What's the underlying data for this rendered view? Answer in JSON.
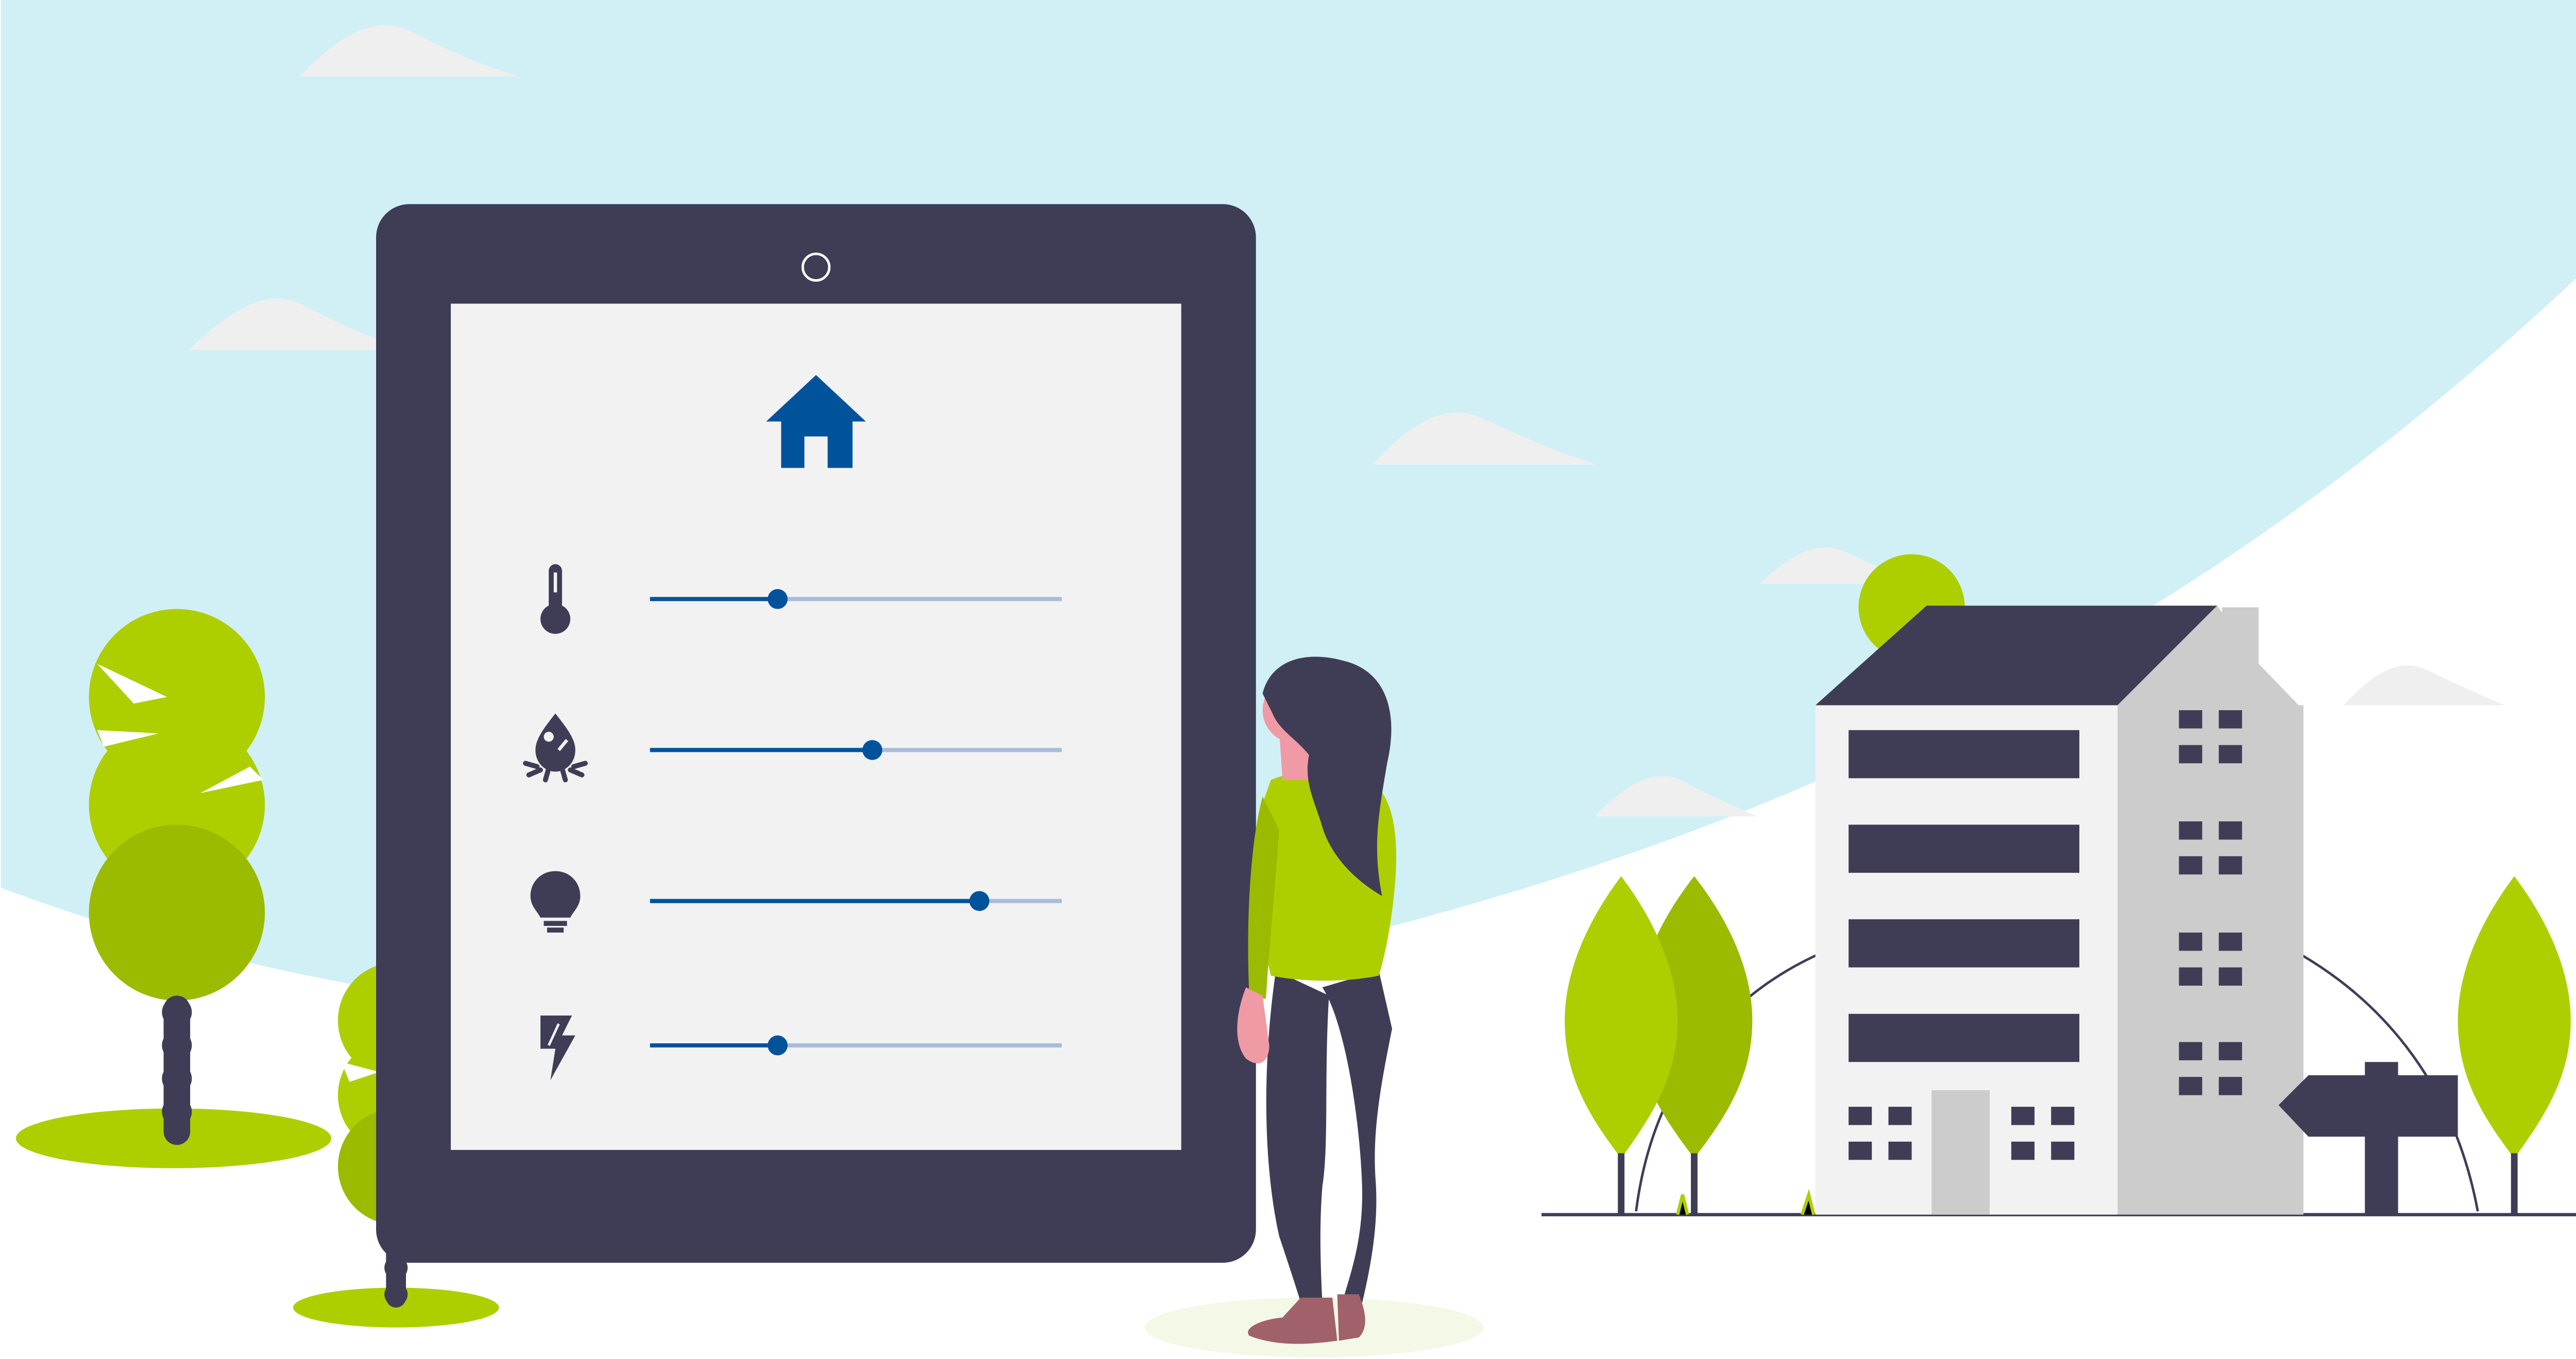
{
  "colors": {
    "sky": "#d0f0f6",
    "ground": "#ffffff",
    "cloud": "#efefef",
    "device_frame": "#3f3d56",
    "screen": "#f2f2f2",
    "accent": "#00529b",
    "slider_track": "#a9bcd8",
    "tree_light": "#adcf00",
    "tree_dark": "#9bbb00",
    "building_front": "#f2f2f2",
    "building_side": "#cccccc",
    "building_dark": "#3f3d56",
    "skin": "#f09aa6",
    "shoe": "#a0616a",
    "ground_shadow": "#f4f8e6"
  },
  "screen": {
    "header_icon": "home-icon",
    "controls": [
      {
        "icon": "thermometer-icon",
        "value_fraction": 0.31
      },
      {
        "icon": "water-drop-icon",
        "value_fraction": 0.54
      },
      {
        "icon": "lightbulb-icon",
        "value_fraction": 0.8
      },
      {
        "icon": "lightning-bolt-icon",
        "value_fraction": 0.31
      }
    ]
  },
  "scenery": {
    "clouds": 7,
    "signpost": "signpost-icon",
    "character": "person-illustration",
    "building": "apartment-building"
  }
}
